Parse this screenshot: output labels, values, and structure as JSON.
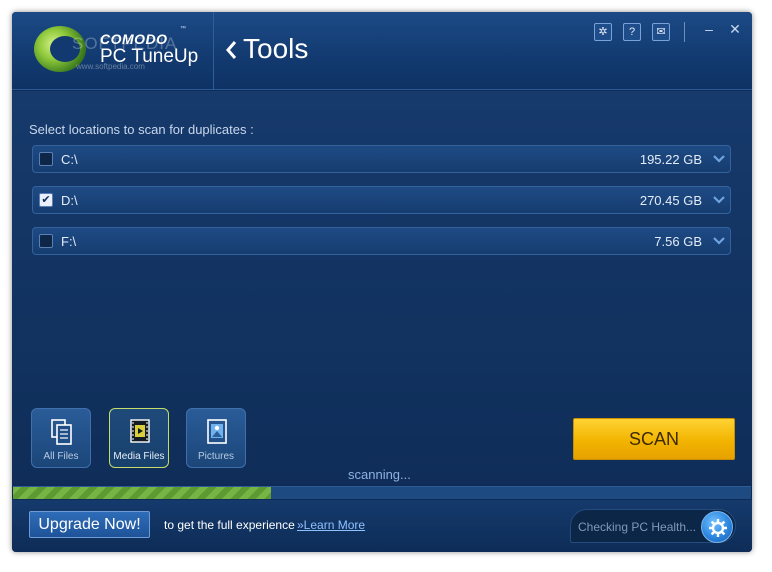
{
  "app": {
    "brand_top": "COMODO",
    "brand_bottom": "PC TuneUp",
    "trademark": "™",
    "watermark": "SOFTPEDIA",
    "watermark_url": "www.softpedia.com"
  },
  "header": {
    "page_title": "Tools",
    "buttons": [
      {
        "name": "settings",
        "icon": "gear-icon",
        "glyph": "✲"
      },
      {
        "name": "help",
        "icon": "question-icon",
        "glyph": "?"
      },
      {
        "name": "feedback",
        "icon": "chat-icon",
        "glyph": "✉"
      }
    ],
    "minimize_glyph": "–",
    "close_glyph": "✕"
  },
  "main": {
    "prompt": "Select locations to scan for duplicates :",
    "drives": [
      {
        "name": "C:\\",
        "size": "195.22 GB",
        "checked": false
      },
      {
        "name": "D:\\",
        "size": "270.45 GB",
        "checked": true
      },
      {
        "name": "F:\\",
        "size": "7.56 GB",
        "checked": false
      }
    ],
    "file_types": [
      {
        "label": "All Files",
        "icon": "documents-icon",
        "active": false
      },
      {
        "label": "Media Files",
        "icon": "film-icon",
        "active": true
      },
      {
        "label": "Pictures",
        "icon": "picture-icon",
        "active": false
      }
    ],
    "scan_label": "SCAN",
    "status": "scanning...",
    "progress": 0.35
  },
  "footer": {
    "upgrade_label": "Upgrade Now!",
    "promo_text": "to get the full experience",
    "learn_more": "»Learn More",
    "health_text": "Checking PC Health..."
  },
  "colors": {
    "background": "#0f2b55",
    "accent_scan": "#f2b400",
    "progress_green": "#76b545",
    "active_border": "#c6dc6a"
  }
}
